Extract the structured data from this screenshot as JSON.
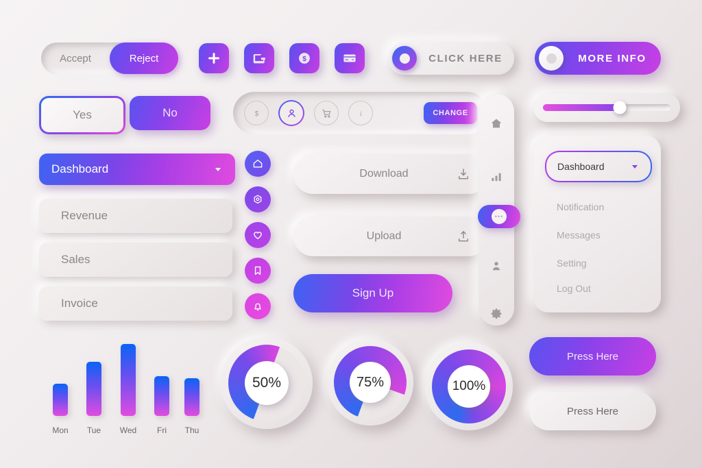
{
  "theme": {
    "bg_start": "#f6f3f4",
    "bg_end": "#dcd3d5",
    "accent_blue": "#3f63f2",
    "accent_purple": "#8b42ea",
    "accent_magenta": "#e04bdf",
    "text_muted": "#8d8688",
    "text_dark": "#3c383a"
  },
  "segmented": {
    "accept_label": "Accept",
    "reject_label": "Reject",
    "selected": "Reject"
  },
  "icon_buttons": [
    {
      "name": "plus-icon",
      "label": "Add"
    },
    {
      "name": "wallet-icon",
      "label": "Wallet"
    },
    {
      "name": "dollar-circle-icon",
      "label": "Payment"
    },
    {
      "name": "credit-card-icon",
      "label": "Card"
    }
  ],
  "toggles": [
    {
      "label": "CLICK HERE",
      "state": "off",
      "style": "light"
    },
    {
      "label": "MORE INFO",
      "state": "on",
      "style": "gradient"
    }
  ],
  "choice_buttons": {
    "yes_label": "Yes",
    "no_label": "No"
  },
  "select_primary": {
    "label": "Dashboard",
    "chevron": "chevron-down-icon"
  },
  "list_rows": [
    {
      "label": "Revenue"
    },
    {
      "label": "Sales"
    },
    {
      "label": "Invoice"
    }
  ],
  "toolbar": {
    "icons": [
      {
        "name": "dollar-icon",
        "active": false
      },
      {
        "name": "user-icon",
        "active": true
      },
      {
        "name": "cart-icon",
        "active": false
      },
      {
        "name": "info-icon",
        "active": false
      }
    ],
    "change_label": "CHANGE"
  },
  "round_icons": [
    {
      "name": "home-icon"
    },
    {
      "name": "settings-hex-icon"
    },
    {
      "name": "heart-icon"
    },
    {
      "name": "bookmark-icon"
    },
    {
      "name": "bell-icon"
    }
  ],
  "action_buttons": {
    "download_label": "Download",
    "download_icon": "download-icon",
    "upload_label": "Upload",
    "upload_icon": "upload-icon",
    "signup_label": "Sign Up"
  },
  "sidebar": {
    "items": [
      {
        "name": "home-icon",
        "active": false
      },
      {
        "name": "bar-chart-icon",
        "active": false
      },
      {
        "name": "chat-icon",
        "active": true
      },
      {
        "name": "user-icon",
        "active": false
      },
      {
        "name": "gear-icon",
        "active": false
      }
    ]
  },
  "slider": {
    "value": 60,
    "min": 0,
    "max": 100
  },
  "dropdown_card": {
    "selected_label": "Dashboard",
    "chevron": "chevron-down-icon",
    "items": [
      {
        "label": "Notification"
      },
      {
        "label": "Messages"
      },
      {
        "label": "Setting"
      },
      {
        "label": "Log Out"
      }
    ]
  },
  "progress_circles": [
    {
      "label": "50%",
      "value": 50
    },
    {
      "label": "75%",
      "value": 75
    },
    {
      "label": "100%",
      "value": 100
    }
  ],
  "press_buttons": [
    {
      "label": "Press Here",
      "style": "gradient"
    },
    {
      "label": "Press Here",
      "style": "light"
    }
  ],
  "chart_data": {
    "type": "bar",
    "title": "",
    "xlabel": "",
    "ylabel": "",
    "categories": [
      "Mon",
      "Tue",
      "Wed",
      "Fri",
      "Thu"
    ],
    "values": [
      45,
      75,
      100,
      55,
      52
    ],
    "ylim": [
      0,
      100
    ],
    "grid": false,
    "legend": "none"
  }
}
